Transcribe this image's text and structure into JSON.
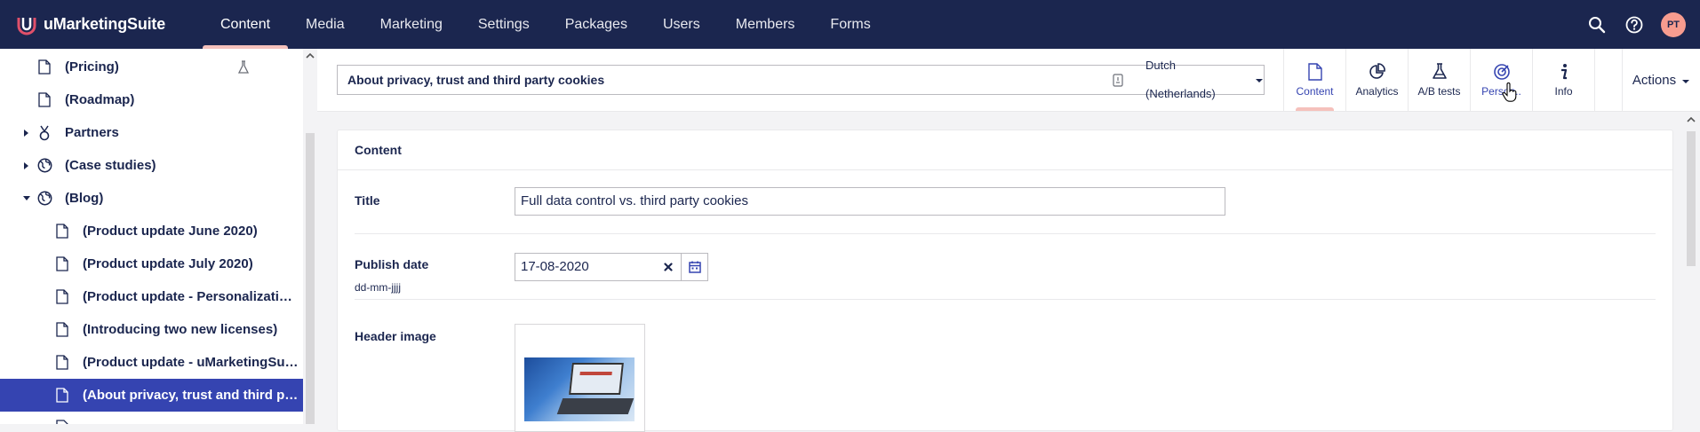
{
  "app": {
    "brand_name": "uMarketingSuite",
    "sections": [
      "Content",
      "Media",
      "Marketing",
      "Settings",
      "Packages",
      "Users",
      "Members",
      "Forms"
    ],
    "active_section": "Content",
    "user_initials": "PT"
  },
  "tree": {
    "items": [
      {
        "label": "(Pricing)",
        "icon": "document-icon",
        "depth": 1,
        "caret": "none",
        "selected": false,
        "extra_icon": "ab-test-flask-icon"
      },
      {
        "label": "(Roadmap)",
        "icon": "document-icon",
        "depth": 1,
        "caret": "none",
        "selected": false
      },
      {
        "label": "Partners",
        "icon": "medal-icon",
        "depth": 1,
        "caret": "right",
        "selected": false
      },
      {
        "label": "(Case studies)",
        "icon": "globe-icon",
        "depth": 1,
        "caret": "right",
        "selected": false
      },
      {
        "label": "(Blog)",
        "icon": "globe-icon",
        "depth": 1,
        "caret": "down",
        "selected": false
      },
      {
        "label": "(Product update June 2020)",
        "icon": "document-icon",
        "depth": 2,
        "caret": "none",
        "selected": false
      },
      {
        "label": "(Product update July 2020)",
        "icon": "document-icon",
        "depth": 2,
        "caret": "none",
        "selected": false
      },
      {
        "label": "(Product update - Personalization i...",
        "icon": "document-icon",
        "depth": 2,
        "caret": "none",
        "selected": false
      },
      {
        "label": "(Introducing two new licenses)",
        "icon": "document-icon",
        "depth": 2,
        "caret": "none",
        "selected": false
      },
      {
        "label": "(Product update - uMarketingSuite...",
        "icon": "document-icon",
        "depth": 2,
        "caret": "none",
        "selected": false
      },
      {
        "label": "(About privacy, trust and third part...",
        "icon": "document-icon",
        "depth": 2,
        "caret": "none",
        "selected": true
      }
    ]
  },
  "editor": {
    "name_value": "About privacy, trust and third party cookies",
    "language": "Dutch (Netherlands)",
    "apps": [
      {
        "label": "Content",
        "icon": "document-icon",
        "active": true
      },
      {
        "label": "Analytics",
        "icon": "pie-chart-icon",
        "active": false
      },
      {
        "label": "A/B tests",
        "icon": "flask-icon",
        "active": false
      },
      {
        "label": "Person..",
        "icon": "target-icon",
        "active": false
      },
      {
        "label": "Info",
        "icon": "info-icon",
        "active": false
      }
    ],
    "actions_label": "Actions"
  },
  "content": {
    "group_title": "Content",
    "title_label": "Title",
    "title_value": "Full data control vs. third party cookies",
    "publish_label": "Publish date",
    "publish_desc": "dd-mm-jjjj",
    "publish_value": "17-08-2020",
    "header_image_label": "Header image"
  }
}
